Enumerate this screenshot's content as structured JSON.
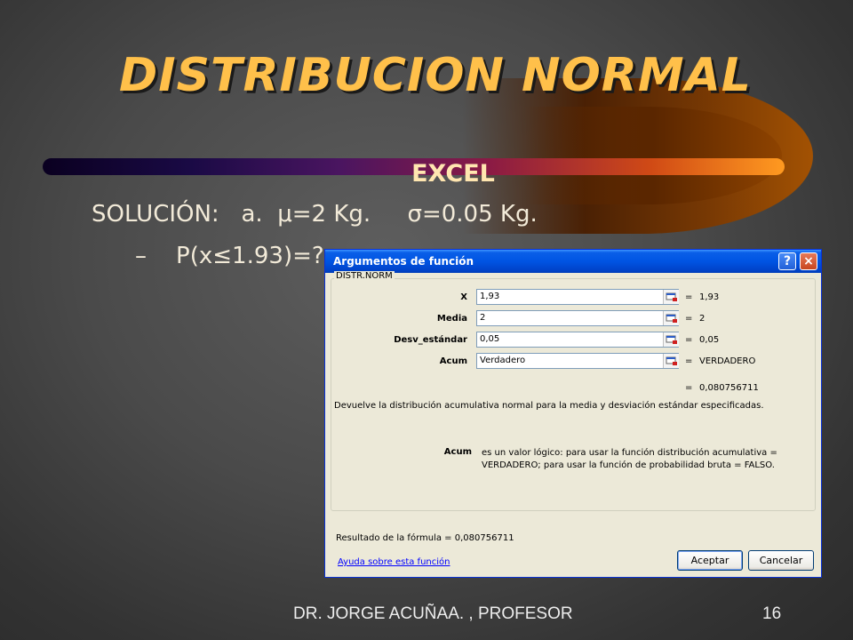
{
  "slide": {
    "title": "DISTRIBUCION NORMAL",
    "subtitle": "EXCEL",
    "line1": "SOLUCIÓN:   a.  μ=2 Kg.     σ=0.05 Kg.",
    "line2": "–    P(x≤1.93)=?",
    "footer": "DR. JORGE ACUÑAA. , PROFESOR",
    "page_number": "16"
  },
  "dialog": {
    "title": "Argumentos de función",
    "help_icon": "?",
    "close_icon": "×",
    "function_name": "DISTR.NORM",
    "args": [
      {
        "label": "X",
        "value": "1,93",
        "result": "1,93"
      },
      {
        "label": "Media",
        "value": "2",
        "result": "2"
      },
      {
        "label": "Desv_estándar",
        "value": "0,05",
        "result": "0,05"
      },
      {
        "label": "Acum",
        "value": "Verdadero",
        "result": "VERDADERO"
      }
    ],
    "equals": "=",
    "result": "0,080756711",
    "description": "Devuelve la distribución acumulativa normal para la media y desviación estándar especificadas.",
    "acum_name": "Acum",
    "acum_help": "es un valor lógico: para usar la función distribución acumulativa = VERDADERO; para usar la función de probabilidad bruta = FALSO.",
    "formula_result_label": "Resultado de la fórmula =",
    "formula_result_value": "0,080756711",
    "help_link": "Ayuda sobre esta función",
    "ok_label": "Aceptar",
    "cancel_label": "Cancelar"
  },
  "colors": {
    "title": "#FFC04A",
    "titlebar": "#0054E3",
    "dialog_bg": "#ECE9D8"
  }
}
